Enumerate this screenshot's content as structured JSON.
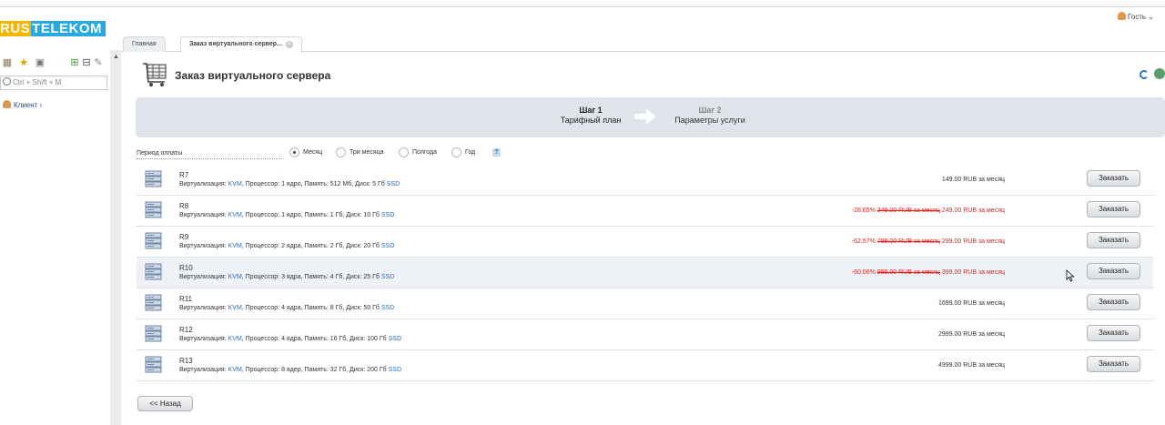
{
  "brand": {
    "logo_part1": "RUS",
    "logo_part2": "TELEKOM"
  },
  "sidebar": {
    "search_placeholder": "Ctrl + Shift + M",
    "client_label": "Клиент ›"
  },
  "user": {
    "label": "Гость ⌄"
  },
  "tabs": [
    {
      "label": "Главная"
    },
    {
      "label": "Заказ виртуального сервер..."
    }
  ],
  "page": {
    "title": "Заказ виртуального сервера"
  },
  "steps": [
    {
      "number": "Шаг 1",
      "title": "Тарифный план"
    },
    {
      "number": "Шаг 2",
      "title": "Параметры услуги"
    }
  ],
  "period": {
    "label": "Период оплаты",
    "options": [
      "Месяц",
      "Три месяца",
      "Полгода",
      "Год"
    ],
    "selected": "Месяц",
    "help": "?"
  },
  "plans": [
    {
      "name": "R7",
      "virt_label": "Виртуализация: ",
      "virt": "KVM",
      "specs": ", Процессор: 1 ядро, Память: 512 Мб, Диск: 5 Гб ",
      "disk_type": "SSD",
      "discount": "",
      "old_price": "",
      "price": "149.00 RUB за месяц",
      "button": "Заказать"
    },
    {
      "name": "R8",
      "virt_label": "Виртуализация: ",
      "virt": "KVM",
      "specs": ", Процессор: 1 ядро, Память: 1 Гб, Диск: 10 Гб ",
      "disk_type": "SSD",
      "discount": "-28.65%",
      "old_price": "349.00 RUB за месяц",
      "price": "249.00 RUB за месяц",
      "button": "Заказать"
    },
    {
      "name": "R9",
      "virt_label": "Виртуализация: ",
      "virt": "KVM",
      "specs": ", Процессор: 2 ядра, Память: 2 Гб, Диск: 20 Гб ",
      "disk_type": "SSD",
      "discount": "-62.57%",
      "old_price": "799.00 RUB за месяц",
      "price": "299.00 RUB за месяц",
      "button": "Заказать"
    },
    {
      "name": "R10",
      "virt_label": "Виртуализация: ",
      "virt": "KVM",
      "specs": ", Процессор: 3 ядра, Память: 4 Гб, Диск: 25 Гб ",
      "disk_type": "SSD",
      "discount": "-60.06%",
      "old_price": "999.00 RUB за месяц",
      "price": "399.00 RUB за месяц",
      "button": "Заказать"
    },
    {
      "name": "R11",
      "virt_label": "Виртуализация: ",
      "virt": "KVM",
      "specs": ", Процессор: 4 ядра, Память: 8 Гб, Диск: 50 Гб ",
      "disk_type": "SSD",
      "discount": "",
      "old_price": "",
      "price": "1699.00 RUB за месяц",
      "button": "Заказать"
    },
    {
      "name": "R12",
      "virt_label": "Виртуализация: ",
      "virt": "KVM",
      "specs": ", Процессор: 4 ядра, Память: 16 Гб, Диск: 100 Гб ",
      "disk_type": "SSD",
      "discount": "",
      "old_price": "",
      "price": "2999.00 RUB за месяц",
      "button": "Заказать"
    },
    {
      "name": "R13",
      "virt_label": "Виртуализация: ",
      "virt": "KVM",
      "specs": ", Процессор: 8 ядер, Память: 32 Гб, Диск: 200 Гб ",
      "disk_type": "SSD",
      "discount": "",
      "old_price": "",
      "price": "4999.00 RUB за месяц",
      "button": "Заказать"
    }
  ],
  "footer": {
    "back_label": "<< Назад"
  },
  "colors": {
    "link": "#2a6fb5",
    "discount": "#e02020",
    "steps_bg": "#dfe4ea",
    "logo_yellow": "#f7b500",
    "logo_blue": "#27a9e1"
  }
}
